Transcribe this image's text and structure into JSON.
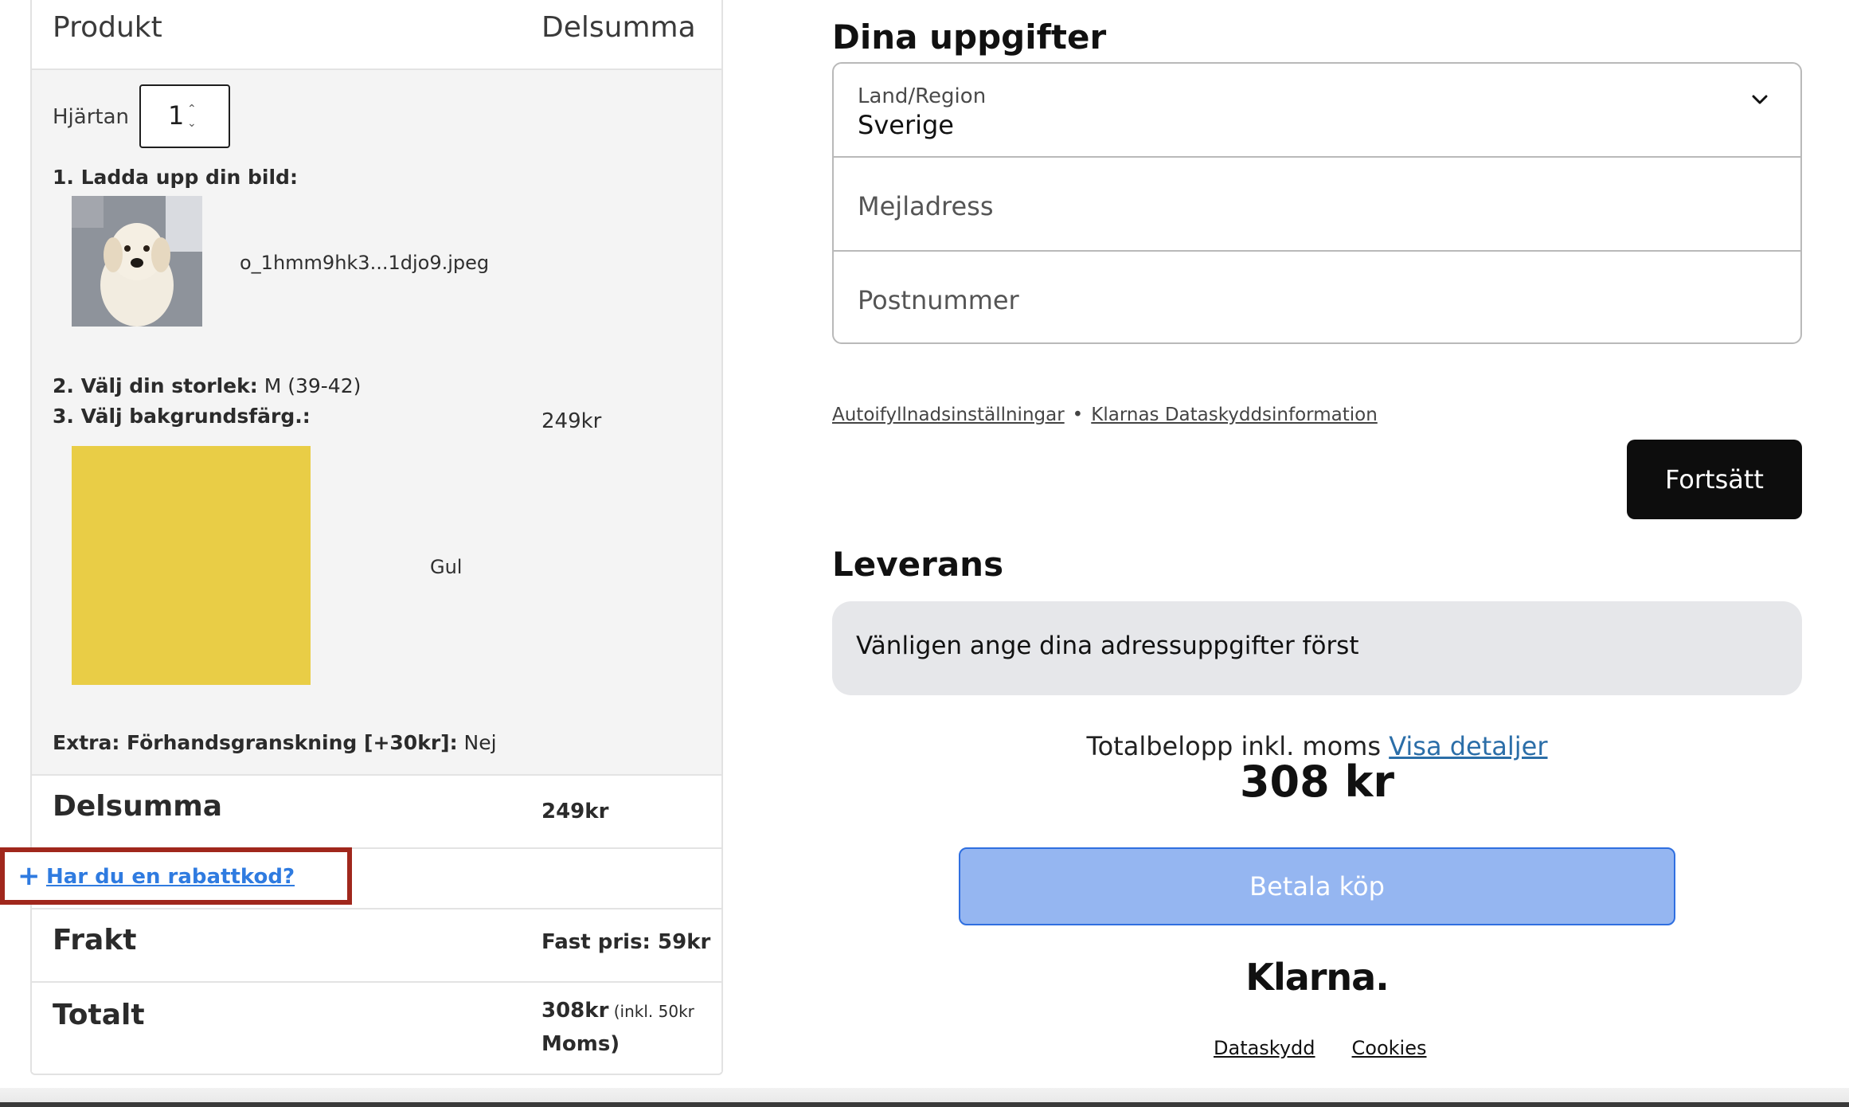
{
  "order": {
    "header": {
      "product": "Produkt",
      "subtotal": "Delsumma"
    },
    "item": {
      "qty_label": "Hjärtan",
      "qty_value": "1",
      "upload_label": "1. Ladda upp din bild:",
      "filename": "o_1hmm9hk3...1djo9.jpeg",
      "size_label": "2. Välj din storlek:",
      "size_value": " M (39-42)",
      "bg_label": "3. Välj bakgrundsfärg.:",
      "color_name": "Gul",
      "swatch_color": "#e9cd46",
      "price": "249kr",
      "extra_label": "Extra: Förhandsgranskning [+30kr]:",
      "extra_value": " Nej"
    },
    "subtotal": {
      "label": "Delsumma",
      "amount": "249kr"
    },
    "coupon_link": "Har du en rabattkod?",
    "shipping": {
      "label": "Frakt",
      "amount": "Fast pris: 59kr"
    },
    "total": {
      "label": "Totalt",
      "amount": "308kr",
      "note1": " (inkl. 50kr",
      "note2": "Moms)"
    }
  },
  "checkout": {
    "details_title": "Dina uppgifter",
    "country_label": "Land/Region",
    "country_value": "Sverige",
    "email_placeholder": "Mejladress",
    "zip_placeholder": "Postnummer",
    "autofill_link": "Autoifyllnadsinställningar",
    "privacy_link": "Klarnas Dataskyddsinformation",
    "continue_button": "Fortsätt",
    "delivery_title": "Leverans",
    "delivery_notice": "Vänligen ange dina adressuppgifter först",
    "total_label": "Totalbelopp inkl. moms ",
    "details_link": "Visa detaljer",
    "total_amount": "308 kr",
    "pay_button": "Betala köp",
    "brand": "Klarna.",
    "footer_privacy": "Dataskydd",
    "footer_cookies": "Cookies"
  },
  "colors": {
    "accent_link": "#2f7be0",
    "highlight_border": "#a0271c",
    "pay_button": "#95b6f1"
  }
}
